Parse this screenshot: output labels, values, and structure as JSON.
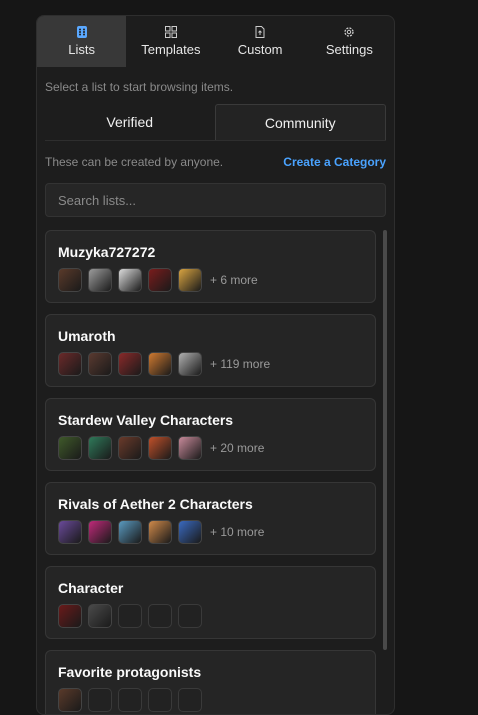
{
  "nav": {
    "tabs": [
      {
        "label": "Lists",
        "icon": "grid-dots-icon"
      },
      {
        "label": "Templates",
        "icon": "grid-squares-icon"
      },
      {
        "label": "Custom",
        "icon": "file-upload-icon"
      },
      {
        "label": "Settings",
        "icon": "gear-icon"
      }
    ],
    "active": "Lists"
  },
  "hint": "Select a list to start browsing items.",
  "segments": {
    "verified": "Verified",
    "community": "Community",
    "active": "Community"
  },
  "info": {
    "text": "These can be created by anyone.",
    "create_link": "Create a Category"
  },
  "search": {
    "placeholder": "Search lists...",
    "value": ""
  },
  "lists": [
    {
      "title": "Muzyka727272",
      "thumbs": [
        "#5a3a2a",
        "#9c9c9c",
        "#dcdcdc",
        "#7a1c1c",
        "#d9a441"
      ],
      "more": "+ 6 more"
    },
    {
      "title": "Umaroth",
      "thumbs": [
        "#6b2a2a",
        "#5a3a30",
        "#8a2a2a",
        "#d07a30",
        "#b0b0b0"
      ],
      "more": "+ 119 more"
    },
    {
      "title": "Stardew Valley Characters",
      "thumbs": [
        "#3f5a2a",
        "#2f7a5a",
        "#6a3a2a",
        "#c0502a",
        "#c88a9a"
      ],
      "more": "+ 20 more"
    },
    {
      "title": "Rivals of Aether 2 Characters",
      "thumbs": [
        "#6a4a9a",
        "#c02a7a",
        "#5a9ac0",
        "#d08a4a",
        "#3a6ac0"
      ],
      "more": "+ 10 more"
    },
    {
      "title": "Character",
      "thumbs": [
        "#6a1a1a",
        "#4a4a4a"
      ],
      "empty_slots": 3,
      "more": ""
    },
    {
      "title": "Favorite protagonists",
      "thumbs": [
        "#5a3a2a"
      ],
      "empty_slots": 4,
      "more": ""
    }
  ],
  "colors": {
    "accent_link": "#4aa3ff",
    "panel_bg": "#1d1d1d",
    "page_bg": "#161616"
  }
}
